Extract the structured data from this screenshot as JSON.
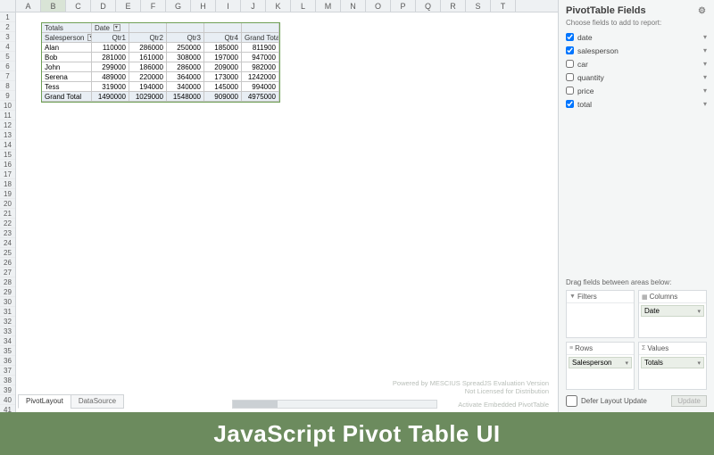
{
  "columns": [
    "A",
    "B",
    "C",
    "D",
    "E",
    "F",
    "G",
    "H",
    "I",
    "J",
    "K",
    "L",
    "M",
    "N",
    "O",
    "P",
    "Q",
    "R",
    "S",
    "T"
  ],
  "row_count": 42,
  "selected_col": "B",
  "pivot": {
    "corner_label": "Totals",
    "col_field_label": "Date",
    "row_field_label": "Salesperson",
    "headers": [
      "Qtr1",
      "Qtr2",
      "Qtr3",
      "Qtr4",
      "Grand Total"
    ],
    "rows": [
      {
        "label": "Alan",
        "vals": [
          110000,
          286000,
          250000,
          185000,
          811900
        ]
      },
      {
        "label": "Bob",
        "vals": [
          281000,
          161000,
          308000,
          197000,
          947000
        ]
      },
      {
        "label": "John",
        "vals": [
          299000,
          186000,
          286000,
          209000,
          982000
        ]
      },
      {
        "label": "Serena",
        "vals": [
          489000,
          220000,
          364000,
          173000,
          1242000
        ]
      },
      {
        "label": "Tess",
        "vals": [
          319000,
          194000,
          340000,
          145000,
          994000
        ]
      }
    ],
    "grand_total": {
      "label": "Grand Total",
      "vals": [
        1490000,
        1029000,
        1548000,
        909000,
        4975000
      ]
    }
  },
  "panel": {
    "title": "PivotTable Fields",
    "subtitle": "Choose fields to add to report:",
    "fields": [
      {
        "name": "date",
        "checked": true
      },
      {
        "name": "salesperson",
        "checked": true
      },
      {
        "name": "car",
        "checked": false
      },
      {
        "name": "quantity",
        "checked": false
      },
      {
        "name": "price",
        "checked": false
      },
      {
        "name": "total",
        "checked": true
      }
    ],
    "drag_label": "Drag fields between areas below:",
    "areas": {
      "filters": {
        "label": "Filters",
        "items": []
      },
      "columns": {
        "label": "Columns",
        "items": [
          "Date"
        ]
      },
      "rows": {
        "label": "Rows",
        "items": [
          "Salesperson"
        ]
      },
      "values": {
        "label": "Values",
        "items": [
          "Totals"
        ]
      }
    },
    "defer_label": "Defer Layout Update",
    "update_btn": "Update"
  },
  "sheets": {
    "active": "PivotLayout",
    "other": "DataSource"
  },
  "watermark": {
    "line1": "Powered by MESCIUS SpreadJS Evaluation Version",
    "line2": "Not Licensed for Distribution",
    "line3": "Activate Embedded PivotTable"
  },
  "banner": "JavaScript Pivot Table UI"
}
